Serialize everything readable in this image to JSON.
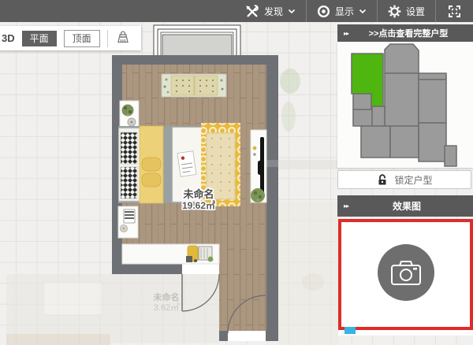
{
  "toolbar": {
    "discover": "发现",
    "display": "显示",
    "settings": "设置"
  },
  "view_bar": {
    "tab_3d": "3D",
    "tab_plan": "平面",
    "tab_ceiling": "顶面"
  },
  "sidebar": {
    "expander": "▸▸",
    "floorplan_header": ">>点击查看完整户型",
    "lock_button": "锁定户型",
    "render_header": "效果图"
  },
  "room": {
    "name": "未命名",
    "area": "19.62㎡"
  },
  "adjacent_room": {
    "name": "未命名",
    "area": "3.62㎡"
  },
  "colors": {
    "toolbar_gray": "#5c5c5c",
    "wall_gray": "#6d7175",
    "floor_wood": "#ab9680",
    "selected_room_green": "#4fb50f",
    "highlight_red": "#e02b2b",
    "rug_yellow": "#e9ba3c"
  }
}
